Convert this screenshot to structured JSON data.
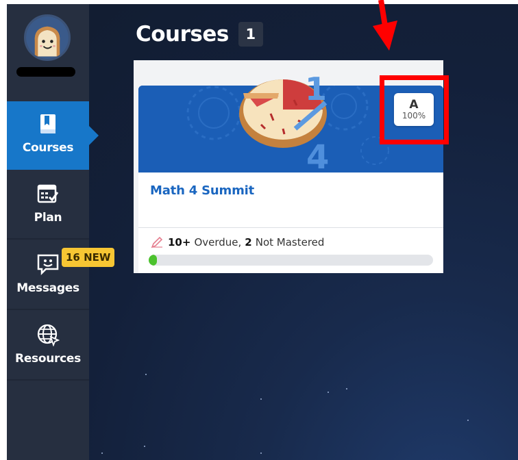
{
  "sidebar": {
    "items": [
      {
        "label": "Courses",
        "icon": "book-icon",
        "active": true
      },
      {
        "label": "Plan",
        "icon": "calendar-check-icon"
      },
      {
        "label": "Messages",
        "icon": "chat-smile-icon"
      },
      {
        "label": "Resources",
        "icon": "globe-cursor-icon"
      }
    ],
    "messages_badge": "16 NEW"
  },
  "header": {
    "title": "Courses",
    "count": "1"
  },
  "course_card": {
    "name": "Math 4 Summit",
    "grade_letter": "A",
    "grade_percent": "100%",
    "overdue_count": "10+",
    "overdue_label": "Overdue,",
    "not_mastered_count": "2",
    "not_mastered_label": "Not Mastered",
    "progress_fraction": 0.03
  },
  "colors": {
    "active_nav": "#1777c9",
    "sidebar_bg": "#262f40",
    "card_banner": "#1b5eb6",
    "course_name": "#1a66c0",
    "badge": "#f7c633",
    "progress": "#4cc22e",
    "annotation": "#ff0000"
  }
}
